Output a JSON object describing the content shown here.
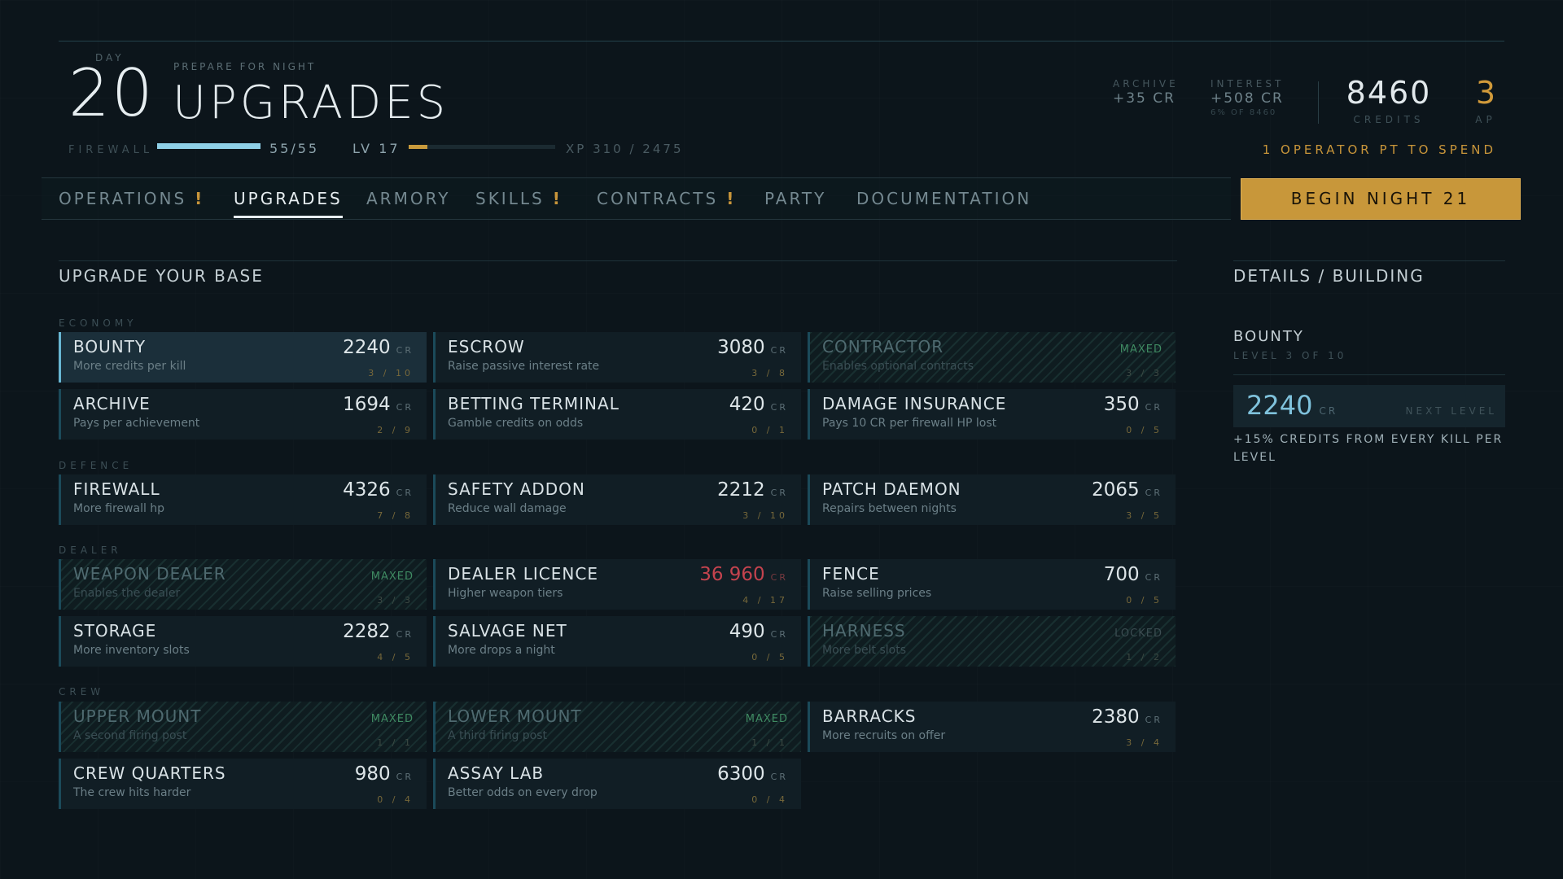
{
  "header": {
    "day_label": "DAY",
    "day_number": "20",
    "prepare_label": "PREPARE FOR NIGHT",
    "page_title": "UPGRADES",
    "firewall_label": "FIREWALL",
    "firewall_value": "55/55",
    "firewall_fraction": 1.0,
    "level_label": "LV 17",
    "xp_value": "XP 310 / 2475",
    "xp_fraction": 0.125,
    "archive_label": "ARCHIVE",
    "archive_value": "+35 CR",
    "interest_label": "INTEREST",
    "interest_value": "+508 CR",
    "interest_note": "6% OF 8460",
    "credits_value": "8460",
    "credits_label": "CREDITS",
    "ap_value": "3",
    "ap_label": "AP",
    "operator_points": "1 OPERATOR PT TO SPEND"
  },
  "nav": {
    "tabs": [
      {
        "label": "OPERATIONS",
        "alert": "!"
      },
      {
        "label": "UPGRADES",
        "alert": ""
      },
      {
        "label": "ARMORY",
        "alert": ""
      },
      {
        "label": "SKILLS",
        "alert": "!"
      },
      {
        "label": "CONTRACTS",
        "alert": "!"
      },
      {
        "label": "PARTY",
        "alert": ""
      },
      {
        "label": "DOCUMENTATION",
        "alert": ""
      }
    ],
    "begin_button": "BEGIN NIGHT 21"
  },
  "main": {
    "title": "UPGRADE YOUR BASE",
    "currency": "CR",
    "groups": [
      {
        "label": "ECONOMY",
        "cards": [
          {
            "name": "BOUNTY",
            "desc": "More credits per kill",
            "price": "2240",
            "status": "",
            "level": "3 / 10"
          },
          {
            "name": "ESCROW",
            "desc": "Raise passive interest rate",
            "price": "3080",
            "status": "",
            "level": "3 / 8"
          },
          {
            "name": "CONTRACTOR",
            "desc": "Enables optional contracts",
            "price": "",
            "status": "MAXED",
            "level": "3 / 3"
          },
          {
            "name": "ARCHIVE",
            "desc": "Pays per achievement",
            "price": "1694",
            "status": "",
            "level": "2 / 9"
          },
          {
            "name": "BETTING TERMINAL",
            "desc": "Gamble credits on odds",
            "price": "420",
            "status": "",
            "level": "0 / 1"
          },
          {
            "name": "DAMAGE INSURANCE",
            "desc": "Pays 10 CR per firewall HP lost",
            "price": "350",
            "status": "",
            "level": "0 / 5"
          }
        ]
      },
      {
        "label": "DEFENCE",
        "cards": [
          {
            "name": "FIREWALL",
            "desc": "More firewall hp",
            "price": "4326",
            "status": "",
            "level": "7 / 8"
          },
          {
            "name": "SAFETY ADDON",
            "desc": "Reduce wall damage",
            "price": "2212",
            "status": "",
            "level": "3 / 10"
          },
          {
            "name": "PATCH DAEMON",
            "desc": "Repairs between nights",
            "price": "2065",
            "status": "",
            "level": "3 / 5"
          }
        ]
      },
      {
        "label": "DEALER",
        "cards": [
          {
            "name": "WEAPON DEALER",
            "desc": "Enables the dealer",
            "price": "",
            "status": "MAXED",
            "level": "3 / 3"
          },
          {
            "name": "DEALER LICENCE",
            "desc": "Higher weapon tiers",
            "price": "36 960",
            "status": "",
            "level": "4 / 17",
            "unaffordable": true
          },
          {
            "name": "FENCE",
            "desc": "Raise selling prices",
            "price": "700",
            "status": "",
            "level": "0 / 5"
          },
          {
            "name": "STORAGE",
            "desc": "More inventory slots",
            "price": "2282",
            "status": "",
            "level": "4 / 5"
          },
          {
            "name": "SALVAGE NET",
            "desc": "More drops a night",
            "price": "490",
            "status": "",
            "level": "0 / 5"
          },
          {
            "name": "HARNESS",
            "desc": "More belt slots",
            "price": "",
            "status": "LOCKED",
            "level": "1 / 2"
          }
        ]
      },
      {
        "label": "CREW",
        "cards": [
          {
            "name": "UPPER MOUNT",
            "desc": "A second firing post",
            "price": "",
            "status": "MAXED",
            "level": "1 / 1"
          },
          {
            "name": "LOWER MOUNT",
            "desc": "A third firing post",
            "price": "",
            "status": "MAXED",
            "level": "1 / 1"
          },
          {
            "name": "BARRACKS",
            "desc": "More recruits on offer",
            "price": "2380",
            "status": "",
            "level": "3 / 4"
          },
          {
            "name": "CREW QUARTERS",
            "desc": "The crew hits harder",
            "price": "980",
            "status": "",
            "level": "0 / 4"
          },
          {
            "name": "ASSAY LAB",
            "desc": "Better odds on every drop",
            "price": "6300",
            "status": "",
            "level": "0 / 4"
          }
        ]
      }
    ]
  },
  "details": {
    "title": "DETAILS / BUILDING",
    "name": "BOUNTY",
    "level": "LEVEL 3 OF 10",
    "cost": "2240",
    "cost_unit": "CR",
    "next_label": "NEXT LEVEL",
    "effect": "+15% CREDITS FROM EVERY KILL PER LEVEL"
  }
}
